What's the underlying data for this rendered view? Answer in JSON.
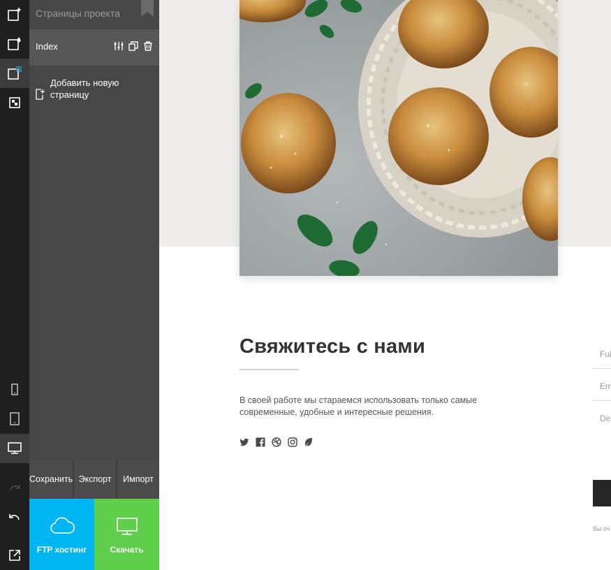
{
  "panel": {
    "title": "Страницы проекта",
    "pages": [
      {
        "name": "Index"
      }
    ],
    "add_page_label": "Добавить новую\nстраницу"
  },
  "actions": {
    "save": "Сохранить",
    "export": "Экспорт",
    "import": "Импорт",
    "ftp": "FTP хостинг",
    "download": "Скачать"
  },
  "rail": {
    "top_icons": [
      "add-block-icon",
      "add-style-icon",
      "pages-icon",
      "media-icon"
    ],
    "device_icons": [
      "mobile-icon",
      "tablet-icon",
      "desktop-icon"
    ],
    "bottom_icons": [
      "redo-icon",
      "undo-icon",
      "preview-icon"
    ]
  },
  "preview": {
    "contact_title": "Свяжитесь с нами",
    "contact_text": "В своей работе мы стараемся использовать только самые современные, удобные и интересные решения.",
    "social_icons": [
      "twitter-icon",
      "facebook-icon",
      "dribbble-icon",
      "instagram-icon",
      "leaf-icon"
    ],
    "form_fields": [
      {
        "placeholder": "Ful"
      },
      {
        "placeholder": "Em"
      },
      {
        "placeholder": "De"
      }
    ],
    "form_note": "Вы оч"
  },
  "colors": {
    "rail_bg": "#1f1f1f",
    "panel_bg": "#474747",
    "ftp_bg": "#00b6f2",
    "download_bg": "#5fcf4b",
    "hero_bg": "#efede9",
    "accent_blue": "#2fa8e8"
  }
}
